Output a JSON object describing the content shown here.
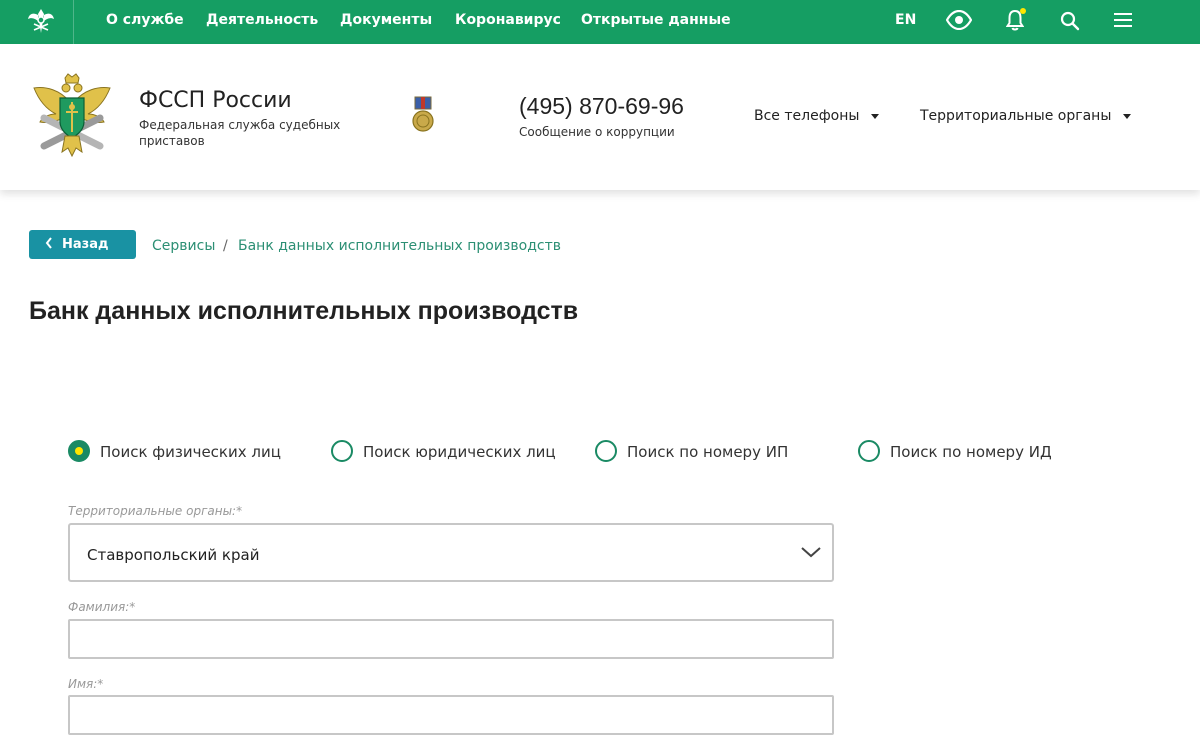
{
  "topnav": {
    "items": [
      "О службе",
      "Деятельность",
      "Документы",
      "Коронавирус",
      "Открытые данные"
    ],
    "lang": "EN",
    "icons": [
      "emblem-icon",
      "eye-icon",
      "bell-icon",
      "search-icon",
      "menu-icon"
    ],
    "bg_color": "#159e63",
    "notification_dot_color": "#ffe500"
  },
  "header": {
    "org_name": "ФССП России",
    "org_subtitle": "Федеральная служба судебных приставов",
    "phone": "(495) 870-69-96",
    "phone_caption": "Сообщение о коррупции",
    "all_phones": "Все телефоны",
    "territorial": "Территориальные органы"
  },
  "breadcrumb": {
    "back": "Назад",
    "items": [
      "Сервисы",
      "Банк данных исполнительных производств"
    ],
    "separator": "/"
  },
  "page_title": "Банк данных исполнительных производств",
  "search_types": [
    {
      "label": "Поиск физических лиц",
      "checked": true
    },
    {
      "label": "Поиск юридических лиц",
      "checked": false
    },
    {
      "label": "Поиск по номеру ИП",
      "checked": false
    },
    {
      "label": "Поиск по номеру ИД",
      "checked": false
    }
  ],
  "form": {
    "region_label": "Территориальные органы:*",
    "region_value": "Ставропольский край",
    "surname_label": "Фамилия:*",
    "surname_value": "",
    "name_label": "Имя:*",
    "name_value": ""
  },
  "colors": {
    "accent_green": "#159e63",
    "back_button": "#1992a3",
    "link": "#2c8f74",
    "radio_dot": "#ffe500"
  }
}
